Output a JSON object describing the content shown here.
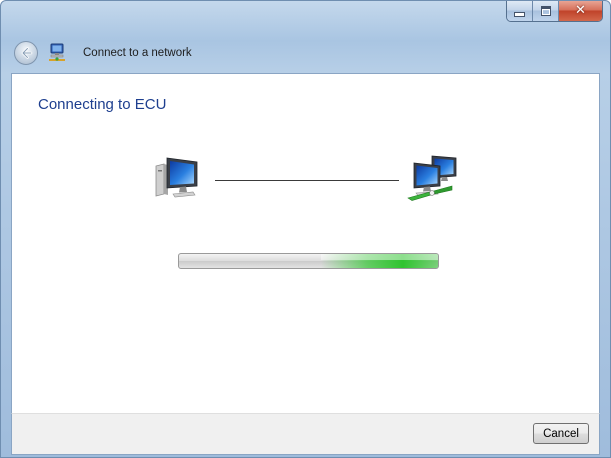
{
  "window": {
    "title": "Connect to a network",
    "caption_buttons": [
      "minimize-icon",
      "maximize-icon",
      "close-icon"
    ]
  },
  "header": {
    "back_icon": "back-arrow-icon",
    "app_icon": "network-connect-icon"
  },
  "main": {
    "heading": "Connecting to ECU",
    "left_icon": "computer-icon",
    "right_icon": "network-icon",
    "progress": {
      "state": "indeterminate",
      "accent_color": "#2fc42f"
    }
  },
  "footer": {
    "cancel_label": "Cancel"
  },
  "colors": {
    "heading": "#1e3f8f",
    "frame": "#a9c5e2",
    "close_button": "#c0432a"
  }
}
